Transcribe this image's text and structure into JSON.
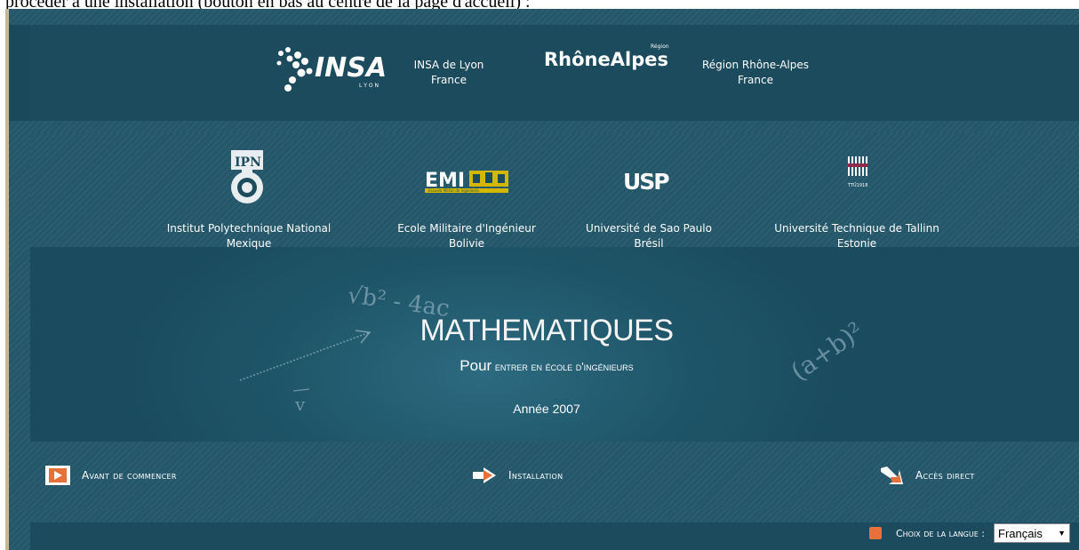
{
  "caption": "procéder à une installation (bouton en bas au centre de la page d'accueil) :",
  "header": {
    "insa_logo_text": "INSA",
    "insa_logo_sub": "L Y O N",
    "insa_line1": "INSA de Lyon",
    "insa_line2": "France",
    "rhone_logo_text": "RhôneAlpes",
    "rhone_logo_sup": "Région",
    "rhone_line1": "Région Rhône-Alpes",
    "rhone_line2": "France"
  },
  "partners": [
    {
      "logo_text": "IPN",
      "line1": "Institut Polytechnique National",
      "line2": "Mexique"
    },
    {
      "logo_text": "EMI",
      "logo_sub": "Escuela Militar de Ingeniería",
      "line1": "Ecole Militaire d'Ingénieur",
      "line2": "Bolivie"
    },
    {
      "logo_text": "USP",
      "line1": "Université de Sao Paulo",
      "line2": "Brésil"
    },
    {
      "logo_text": "TTÜ1918",
      "line1": "Université Technique de Tallinn",
      "line2": "Estonie"
    }
  ],
  "hero": {
    "title": "MATHEMATIQUES",
    "sub_big": "Pour",
    "sub_rest": "entrer en école d'ingénieurs",
    "year": "Année 2007",
    "formula_left": "√b² - 4ac",
    "vector": "v",
    "formula_right": "(a+b)²"
  },
  "nav": {
    "before": "Avant de commencer",
    "install": "Installation",
    "direct": "Accès direct"
  },
  "footer": {
    "lang_label": "Choix de la langue :",
    "lang_value": "Français",
    "select_arrow": "▼"
  },
  "colors": {
    "background": "#194a5c",
    "accent": "#e8713a"
  }
}
